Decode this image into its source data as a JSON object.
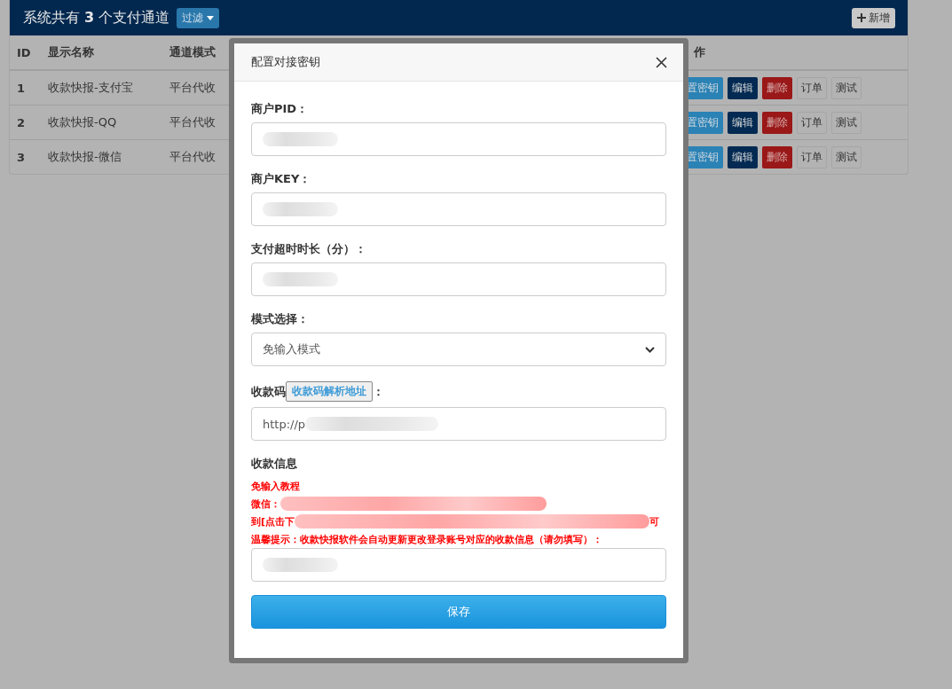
{
  "header": {
    "title": "系统共有 **3** 个支付通道",
    "filter_button": "过滤",
    "add_button": "新增"
  },
  "table": {
    "columns": [
      "ID",
      "显示名称",
      "通道模式",
      "作"
    ],
    "rows": [
      {
        "id": "1",
        "name": "收款快报-支付宝",
        "mode": "平台代收",
        "actions": [
          {
            "label": "置密钥",
            "kind": "primary"
          },
          {
            "label": "编辑",
            "kind": "dark"
          },
          {
            "label": "删除",
            "kind": "danger"
          },
          {
            "label": "订单",
            "kind": "default"
          },
          {
            "label": "测试",
            "kind": "default"
          }
        ]
      },
      {
        "id": "2",
        "name": "收款快报-QQ",
        "mode": "平台代收",
        "actions": [
          {
            "label": "置密钥",
            "kind": "primary"
          },
          {
            "label": "编辑",
            "kind": "dark"
          },
          {
            "label": "删除",
            "kind": "danger"
          },
          {
            "label": "订单",
            "kind": "default"
          },
          {
            "label": "测试",
            "kind": "default"
          }
        ]
      },
      {
        "id": "3",
        "name": "收款快报-微信",
        "mode": "平台代收",
        "actions": [
          {
            "label": "置密钥",
            "kind": "primary"
          },
          {
            "label": "编辑",
            "kind": "dark"
          },
          {
            "label": "删除",
            "kind": "danger"
          },
          {
            "label": "订单",
            "kind": "default"
          },
          {
            "label": "测试",
            "kind": "default"
          }
        ]
      }
    ]
  },
  "modal": {
    "title": "配置对接密钥",
    "fields": [
      {
        "kind": "input",
        "label": "商户PID：",
        "redacted": true
      },
      {
        "kind": "input",
        "label": "商户KEY：",
        "redacted": true
      },
      {
        "kind": "input",
        "label": "支付超时时长（分）：",
        "redacted": true
      },
      {
        "kind": "select",
        "label": "模式选择：",
        "value": "免输入模式"
      },
      {
        "kind": "input",
        "label": "收款码",
        "link": "收款码解析地址",
        "label_suffix": "：",
        "value": "http://p",
        "redacted": true
      },
      {
        "kind": "info",
        "label": "收款信息",
        "redacted": true,
        "notes": [
          {
            "text": "免输入教程",
            "redacted": false
          },
          {
            "text": "微信：",
            "redacted": true
          },
          {
            "text": "到[点击下",
            "redacted": true,
            "tail": "可"
          },
          {
            "text": "温馨提示：收款快报软件会自动更新更改登录账号对应的收款信息（请勿填写）：",
            "redacted": false
          }
        ]
      }
    ],
    "save_button": "保存"
  }
}
